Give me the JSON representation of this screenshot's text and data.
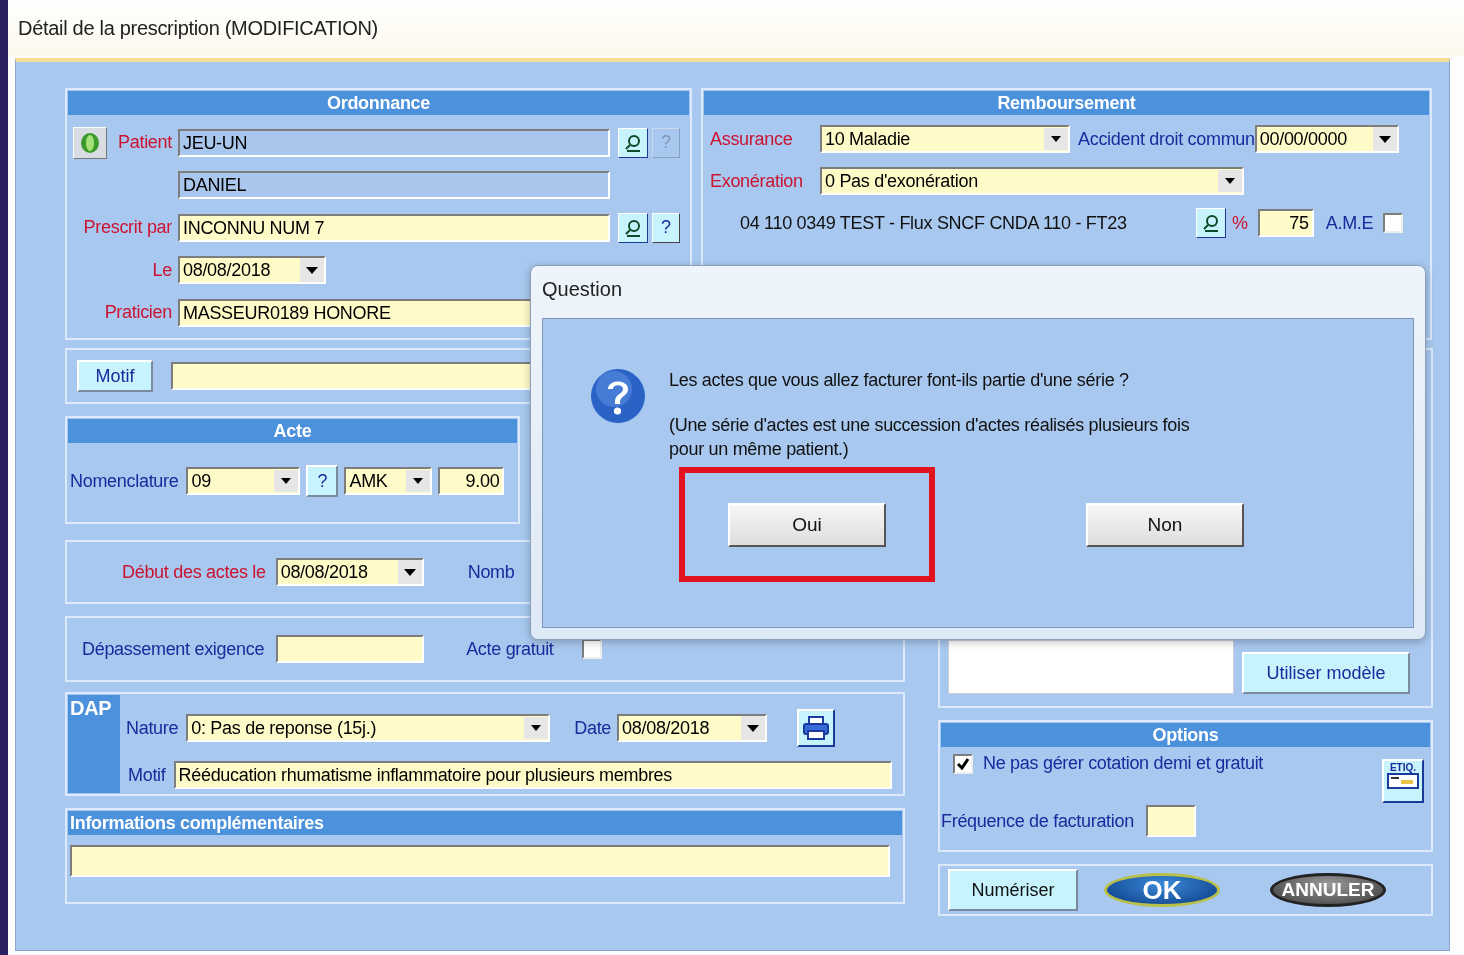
{
  "window": {
    "title": "Détail de la prescription (MODIFICATION)"
  },
  "ordonnance": {
    "title": "Ordonnance",
    "patient": {
      "label": "Patient",
      "last_name": "JEU-UN",
      "first_name": "DANIEL",
      "help": "?",
      "help_disabled": true
    },
    "prescriber": {
      "label": "Prescrit par",
      "value": "INCONNU NUM 7",
      "help": "?",
      "help_disabled": false
    },
    "date": {
      "label": "Le",
      "value": "08/08/2018"
    },
    "practitioner": {
      "label": "Praticien",
      "value": "MASSEUR0189 HONORE"
    }
  },
  "remboursement": {
    "title": "Remboursement",
    "assurance": {
      "label": "Assurance",
      "value": "10  Maladie"
    },
    "accident": {
      "label": "Accident droit commun",
      "value": "00/00/0000"
    },
    "exoneration": {
      "label": "Exonération",
      "value": "0  Pas d'exonération"
    },
    "organisms": [
      {
        "name": "04 110 0349 TEST - Flux SNCF CNDA 110 - FT23",
        "percent_sign": "%",
        "rate": "75",
        "ame_label": "A.M.E",
        "ame_checked": false
      }
    ]
  },
  "motif_button": "Motif",
  "acte": {
    "title": "Acte",
    "nomenclature_label": "Nomenclature",
    "nomenclature": "09",
    "help": "?",
    "letter": "AMK",
    "coefficient": "9.00"
  },
  "debut": {
    "label": "Début des actes le",
    "value": "08/08/2018",
    "count_label": "Nomb"
  },
  "depassement": {
    "label": "Dépassement exigence",
    "free_label": "Acte gratuit",
    "free_checked": false
  },
  "dap": {
    "title": "DAP",
    "nature_label": "Nature",
    "nature": "0: Pas de reponse (15j.)",
    "date_label": "Date",
    "date": "08/08/2018",
    "motif_label": "Motif",
    "motif": "Rééducation rhumatisme inflammatoire pour plusieurs membres"
  },
  "informations": {
    "title": "Informations complémentaires"
  },
  "model_button": "Utiliser modèle",
  "options": {
    "title": "Options",
    "items": [
      {
        "label": "Ne pas gérer cotation demi et gratuit",
        "checked": true
      }
    ],
    "label_icon_text": "ETIQ.",
    "frequency_label": "Fréquence de facturation"
  },
  "actions": [
    {
      "label": "Numériser",
      "kind": "plain"
    },
    {
      "label": "OK",
      "kind": "ok"
    },
    {
      "label": "ANNULER",
      "kind": "cancel"
    }
  ],
  "dialog": {
    "title": "Question",
    "message": "Les actes que vous allez facturer font-ils partie d'une série ?",
    "note_lines": [
      "(Une série d'actes est une succession d'actes réalisés plusieurs fois",
      "pour un même patient.)"
    ],
    "buttons": [
      {
        "label": "Oui",
        "highlighted": true
      },
      {
        "label": "Non",
        "highlighted": false
      }
    ]
  }
}
